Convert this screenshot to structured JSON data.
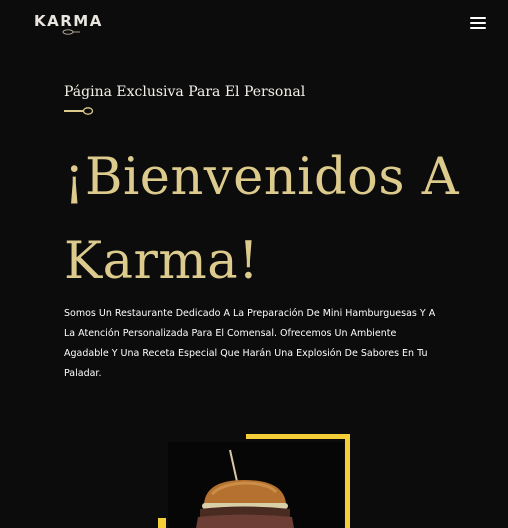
{
  "header": {
    "logo_text": "KARMA",
    "logo_icon": "pan-icon",
    "menu_icon": "menu-icon"
  },
  "hero": {
    "eyebrow": "Página Exclusiva Para El Personal",
    "divider_icon": "spoon-divider-icon",
    "title_line1": "¡Bienvenidos A",
    "title_line2": "Karma!",
    "description": "Somos Un Restaurante Dedicado A La Preparación De Mini Hamburguesas Y A La Atención Personalizada Para El Comensal. Ofrecemos Un Ambiente Agadable Y Una Receta Especial Que Harán Una Explosión De Sabores En Tu Paladar."
  },
  "visual": {
    "image": "mini-burger-photo",
    "frame_color": "#f4cf3a"
  },
  "colors": {
    "background": "#0d0c0c",
    "accent_gold": "#dccb8c",
    "frame_yellow": "#f4cf3a",
    "text": "#ffffff"
  }
}
